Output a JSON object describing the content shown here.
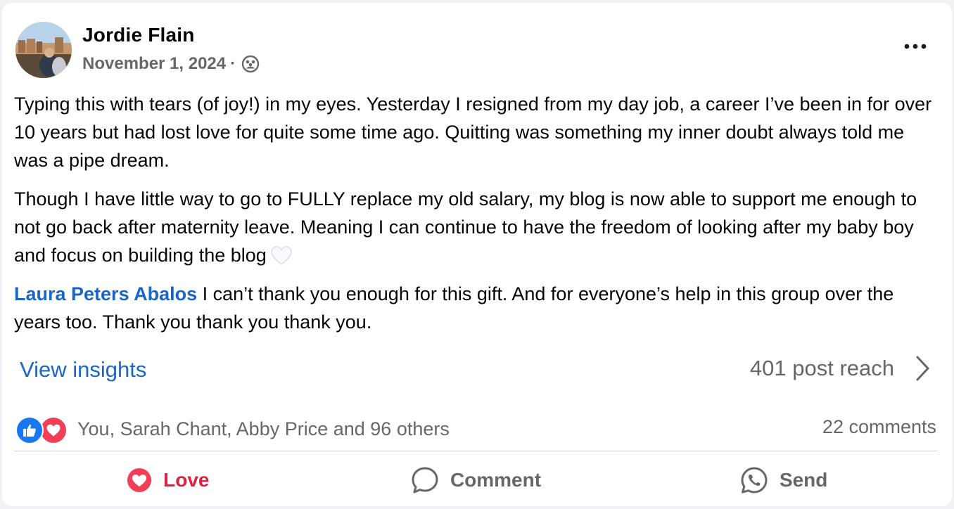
{
  "post": {
    "author": "Jordie Flain",
    "date": "November 1, 2024",
    "separator": "·",
    "audience_icon": "group-icon",
    "more_icon": "more-options-icon",
    "paragraphs": [
      "Typing this with tears (of joy!) in my eyes. Yesterday I resigned from my day job, a career I’ve been in for over 10 years but had lost love for quite some time ago. Quitting was something my inner doubt always told me was a pipe dream.",
      "Though I have little way to go to FULLY replace my old salary, my blog is now able to support me enough to not go back after maternity leave. Meaning I can continue to have the freedom of looking after my baby boy and focus on building the blog"
    ],
    "heart_emoji": "white-heart-emoji",
    "mention": "Laura Peters Abalos",
    "mention_text": " I can’t thank you enough for this gift. And for everyone’s help in this group over the years too. Thank you thank you thank you."
  },
  "insights": {
    "link": "View insights",
    "reach": "401 post reach"
  },
  "reactions": {
    "icons": [
      "like-icon",
      "love-icon"
    ],
    "summary": "You, Sarah Chant, Abby Price and 96 others",
    "comments": "22 comments"
  },
  "actions": {
    "love": "Love",
    "comment": "Comment",
    "send": "Send"
  },
  "colors": {
    "link_blue": "#1a66c7",
    "love_red": "#e41e3f",
    "muted": "#65676b"
  }
}
